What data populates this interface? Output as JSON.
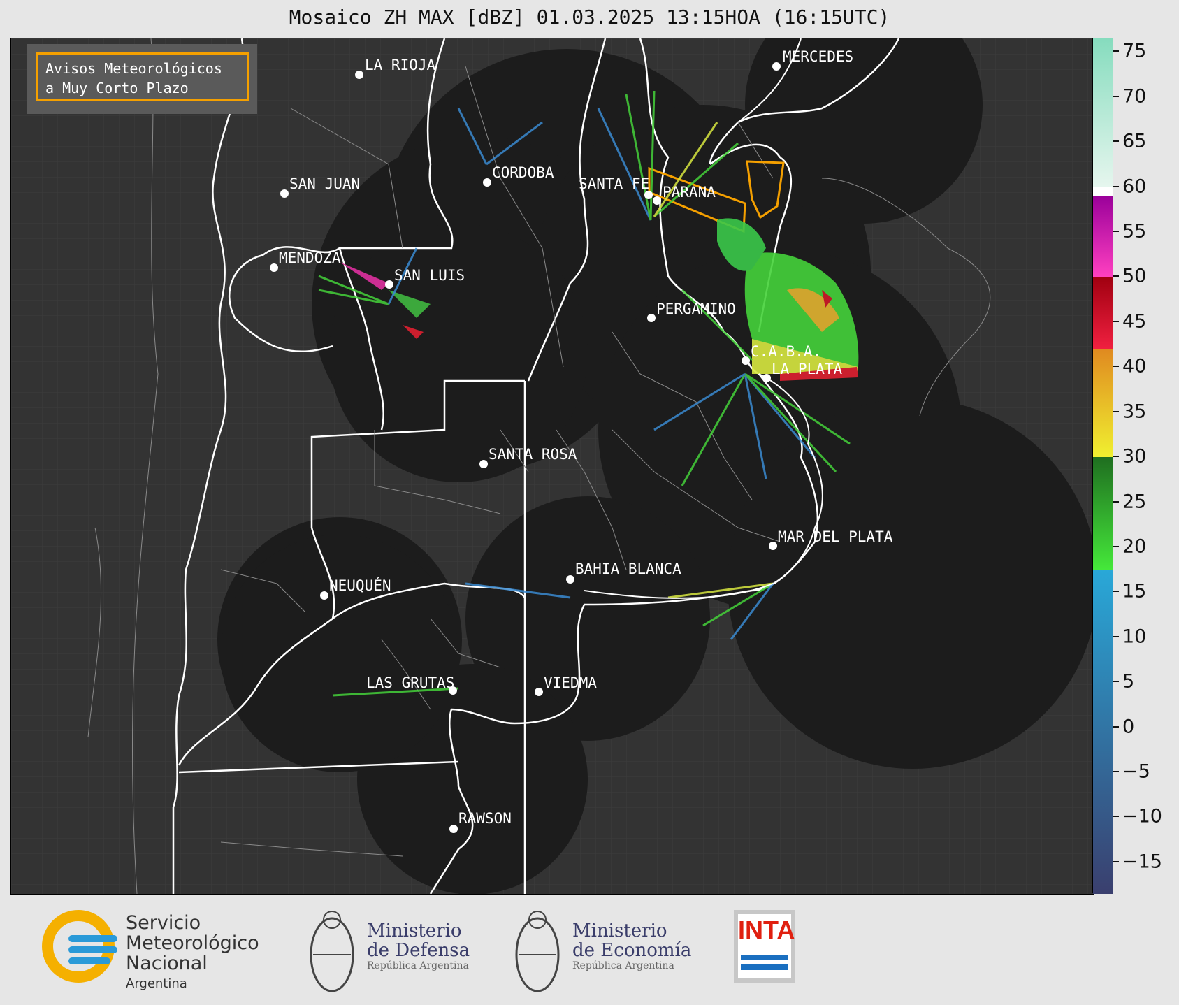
{
  "title": "Mosaico ZH MAX [dBZ] 01.03.2025 13:15HOA (16:15UTC)",
  "legend": {
    "line1": "Avisos Meteorológicos",
    "line2": "a Muy Corto Plazo"
  },
  "colorbar": {
    "ticks": [
      "75",
      "70",
      "65",
      "60",
      "55",
      "50",
      "45",
      "40",
      "35",
      "30",
      "25",
      "20",
      "15",
      "10",
      "5",
      "0",
      "−5",
      "−10",
      "−15"
    ],
    "tick_values": [
      75,
      70,
      65,
      60,
      55,
      50,
      45,
      40,
      35,
      30,
      25,
      20,
      15,
      10,
      5,
      0,
      -5,
      -10,
      -15
    ],
    "range": [
      -18.5,
      76.5
    ],
    "bands": [
      {
        "from": -18.5,
        "to": 17.5,
        "color_top": "#29a8d8",
        "color_bottom": "#3a3f6e"
      },
      {
        "from": 17.5,
        "to": 30,
        "color_top": "#1f6e20",
        "color_bottom": "#45e83a"
      },
      {
        "from": 30,
        "to": 42,
        "color_top": "#e08a20",
        "color_bottom": "#f0f030"
      },
      {
        "from": 42,
        "to": 50,
        "color_top": "#a00010",
        "color_bottom": "#f02040"
      },
      {
        "from": 50,
        "to": 59,
        "color_top": "#9a009a",
        "color_bottom": "#ff40c0"
      },
      {
        "from": 59,
        "to": 60,
        "color_top": "#ffffff",
        "color_bottom": "#ffffff"
      },
      {
        "from": 60,
        "to": 76.5,
        "color_top": "#86dcbe",
        "color_bottom": "#e6f6ee"
      }
    ]
  },
  "cities": [
    {
      "name": "LA RIOJA"
    },
    {
      "name": "MERCEDES"
    },
    {
      "name": "CORDOBA"
    },
    {
      "name": "SAN JUAN"
    },
    {
      "name": "SANTA FE"
    },
    {
      "name": "PARANA"
    },
    {
      "name": "MENDOZA"
    },
    {
      "name": "SAN LUIS"
    },
    {
      "name": "PERGAMINO"
    },
    {
      "name": "C.A.B.A."
    },
    {
      "name": "LA PLATA"
    },
    {
      "name": "SANTA ROSA"
    },
    {
      "name": "MAR DEL PLATA"
    },
    {
      "name": "BAHIA BLANCA"
    },
    {
      "name": "NEUQUÉN"
    },
    {
      "name": "LAS GRUTAS"
    },
    {
      "name": "VIEDMA"
    },
    {
      "name": "RAWSON"
    }
  ],
  "footer": {
    "smn": {
      "line1": "Servicio",
      "line2": "Meteorológico",
      "line3": "Nacional",
      "line4": "Argentina"
    },
    "defensa": {
      "line1": "Ministerio",
      "line2": "de Defensa",
      "line3": "República Argentina"
    },
    "economia": {
      "line1": "Ministerio",
      "line2": "de Economía",
      "line3": "República Argentina"
    },
    "inta": "INTA"
  }
}
